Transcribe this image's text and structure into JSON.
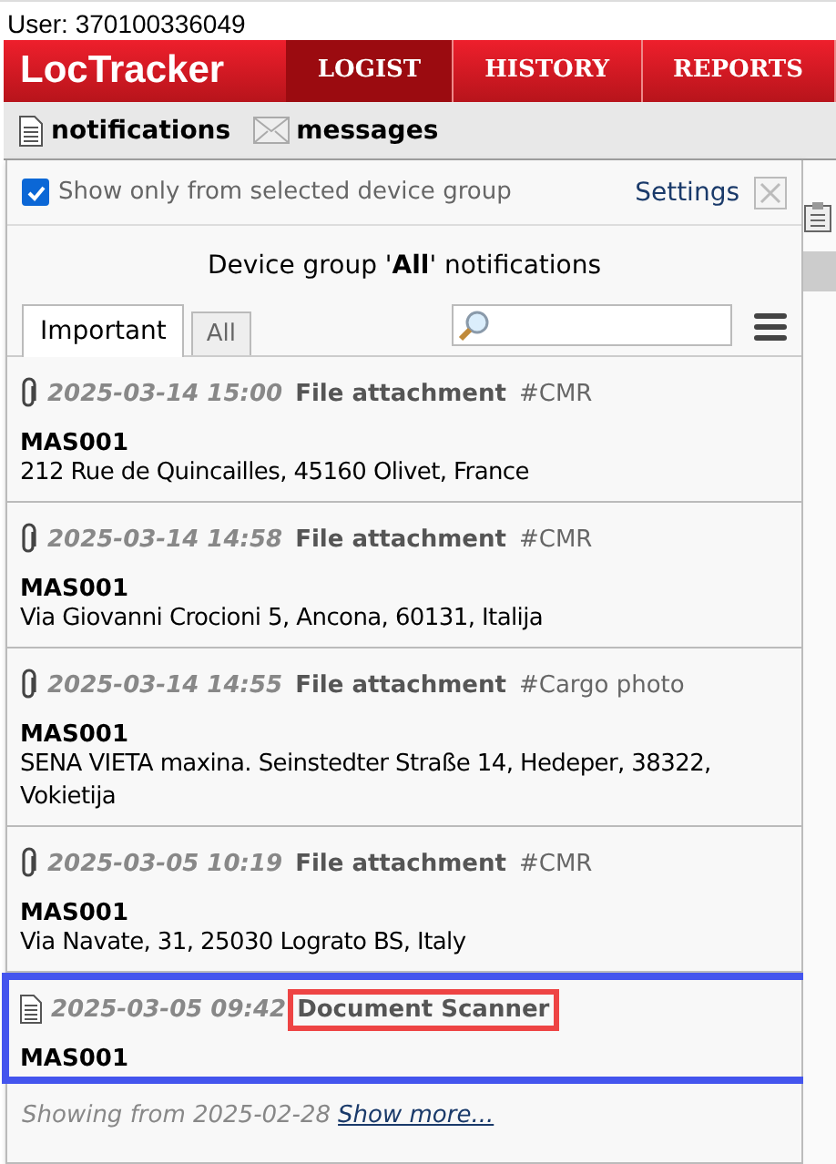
{
  "user": "User: 370100336049",
  "navbar": {
    "logo": "LocTracker",
    "tabs": [
      {
        "label": "LOGIST",
        "selected": true
      },
      {
        "label": "HISTORY",
        "selected": false
      },
      {
        "label": "REPORTS",
        "selected": false
      }
    ]
  },
  "toolbar": [
    {
      "label": "notifications",
      "kind": "document"
    },
    {
      "label": "messages",
      "kind": "envelope"
    }
  ],
  "popup": {
    "filter": {
      "label": "Show only from selected device group",
      "checked": true
    },
    "settings": "Settings",
    "heading": "Device group '**All**' notifications",
    "tabs": [
      {
        "label": "Important",
        "selected": true
      },
      {
        "label": "All",
        "selected": false
      }
    ],
    "notifications": [
      {
        "kind": "attachment",
        "time": "2025-03-14 15:00",
        "title": "File attachment",
        "tag": "#CMR",
        "device": "MAS001",
        "address": "212 Rue de Quincailles, 45160 Olivet, France",
        "outlined": false,
        "title_boxed": false
      },
      {
        "kind": "attachment",
        "time": "2025-03-14 14:58",
        "title": "File attachment",
        "tag": "#CMR",
        "device": "MAS001",
        "address": "Via Giovanni Crocioni 5, Ancona, 60131, Italija",
        "outlined": false,
        "title_boxed": false
      },
      {
        "kind": "attachment",
        "time": "2025-03-14 14:55",
        "title": "File attachment",
        "tag": "#Cargo photo",
        "device": "MAS001",
        "address": "SENA VIETA maxina. Seinstedter Straße 14, Hedeper, 38322, Vokietija",
        "outlined": false,
        "title_boxed": false
      },
      {
        "kind": "attachment",
        "time": "2025-03-05 10:19",
        "title": "File attachment",
        "tag": "#CMR",
        "device": "MAS001",
        "address": "Via Navate, 31, 25030 Lograto BS, Italy",
        "outlined": false,
        "title_boxed": false
      },
      {
        "kind": "document",
        "time": "2025-03-05 09:42",
        "title": "Document Scanner",
        "device": "MAS001",
        "outlined": true,
        "title_boxed": true
      }
    ],
    "footer": {
      "text": "Showing from 2025-02-28",
      "link": "Show more..."
    }
  }
}
